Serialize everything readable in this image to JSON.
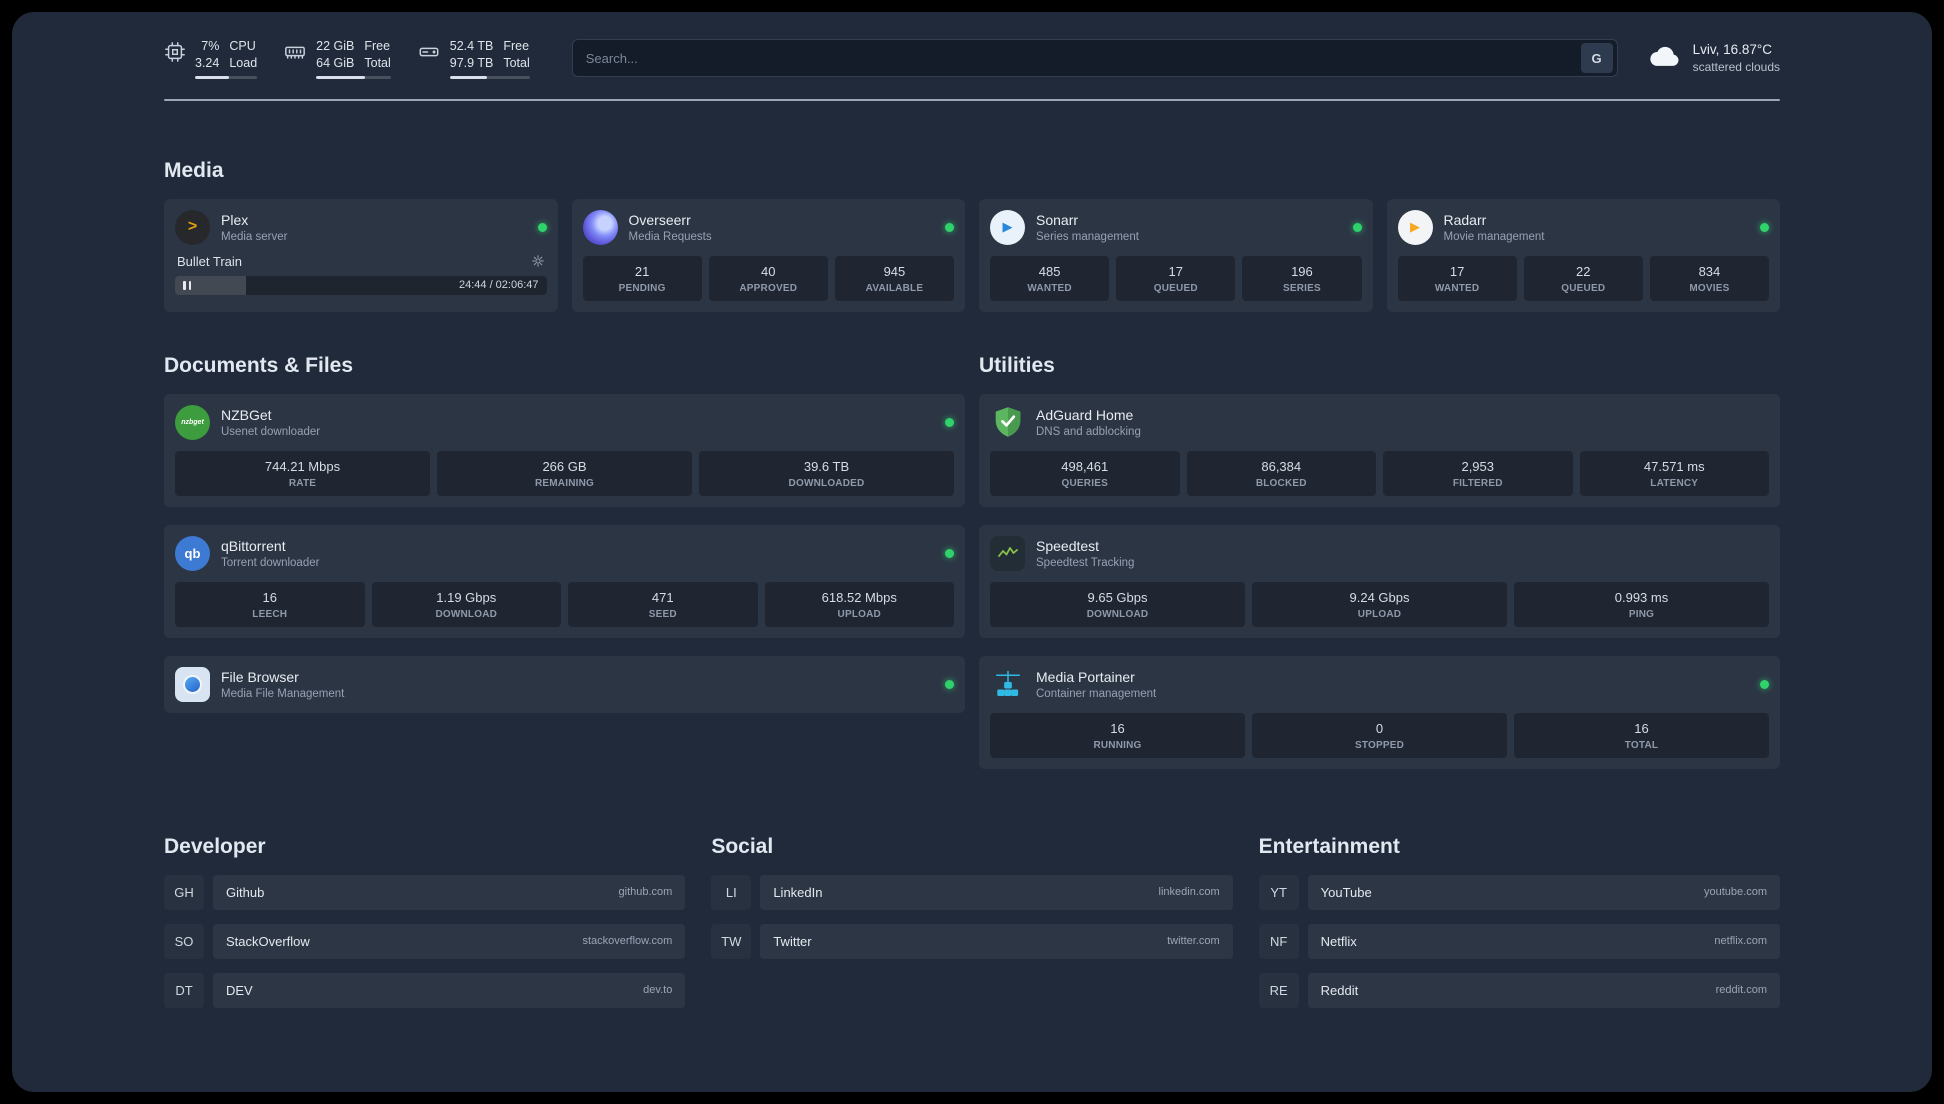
{
  "topbar": {
    "cpu": {
      "value1": "7%",
      "value2": "3.24",
      "label1": "CPU",
      "label2": "Load",
      "bar_percent": 55
    },
    "memory": {
      "value1": "22 GiB",
      "value2": "64 GiB",
      "label1": "Free",
      "label2": "Total",
      "bar_percent": 66
    },
    "disk": {
      "value1": "52.4 TB",
      "value2": "97.9 TB",
      "label1": "Free",
      "label2": "Total",
      "bar_percent": 47
    },
    "search": {
      "placeholder": "Search...",
      "provider_button": "G"
    },
    "weather": {
      "location": "Lviv, 16.87°C",
      "condition": "scattered clouds"
    }
  },
  "sections": {
    "media": {
      "title": "Media",
      "plex": {
        "name": "Plex",
        "desc": "Media server",
        "status": "online",
        "player": {
          "title": "Bullet Train",
          "time": "24:44 / 02:06:47",
          "progress_percent": 19
        }
      },
      "overseerr": {
        "name": "Overseerr",
        "desc": "Media Requests",
        "status": "online",
        "stats": [
          {
            "value": "21",
            "label": "PENDING"
          },
          {
            "value": "40",
            "label": "APPROVED"
          },
          {
            "value": "945",
            "label": "AVAILABLE"
          }
        ]
      },
      "sonarr": {
        "name": "Sonarr",
        "desc": "Series management",
        "status": "online",
        "stats": [
          {
            "value": "485",
            "label": "WANTED"
          },
          {
            "value": "17",
            "label": "QUEUED"
          },
          {
            "value": "196",
            "label": "SERIES"
          }
        ]
      },
      "radarr": {
        "name": "Radarr",
        "desc": "Movie management",
        "status": "online",
        "stats": [
          {
            "value": "17",
            "label": "WANTED"
          },
          {
            "value": "22",
            "label": "QUEUED"
          },
          {
            "value": "834",
            "label": "MOVIES"
          }
        ]
      }
    },
    "documents": {
      "title": "Documents & Files",
      "nzbget": {
        "name": "NZBGet",
        "desc": "Usenet downloader",
        "status": "online",
        "icon_label": "nzbget",
        "stats": [
          {
            "value": "744.21 Mbps",
            "label": "RATE"
          },
          {
            "value": "266 GB",
            "label": "REMAINING"
          },
          {
            "value": "39.6 TB",
            "label": "DOWNLOADED"
          }
        ]
      },
      "qbittorrent": {
        "name": "qBittorrent",
        "desc": "Torrent downloader",
        "status": "online",
        "icon_label": "qb",
        "stats": [
          {
            "value": "16",
            "label": "LEECH"
          },
          {
            "value": "1.19 Gbps",
            "label": "DOWNLOAD"
          },
          {
            "value": "471",
            "label": "SEED"
          },
          {
            "value": "618.52 Mbps",
            "label": "UPLOAD"
          }
        ]
      },
      "filebrowser": {
        "name": "File Browser",
        "desc": "Media File Management",
        "status": "online"
      }
    },
    "utilities": {
      "title": "Utilities",
      "adguard": {
        "name": "AdGuard Home",
        "desc": "DNS and adblocking",
        "stats": [
          {
            "value": "498,461",
            "label": "QUERIES"
          },
          {
            "value": "86,384",
            "label": "BLOCKED"
          },
          {
            "value": "2,953",
            "label": "FILTERED"
          },
          {
            "value": "47.571 ms",
            "label": "LATENCY"
          }
        ]
      },
      "speedtest": {
        "name": "Speedtest",
        "desc": "Speedtest Tracking",
        "stats": [
          {
            "value": "9.65 Gbps",
            "label": "DOWNLOAD"
          },
          {
            "value": "9.24 Gbps",
            "label": "UPLOAD"
          },
          {
            "value": "0.993 ms",
            "label": "PING"
          }
        ]
      },
      "portainer": {
        "name": "Media Portainer",
        "desc": "Container management",
        "status": "online",
        "stats": [
          {
            "value": "16",
            "label": "RUNNING"
          },
          {
            "value": "0",
            "label": "STOPPED"
          },
          {
            "value": "16",
            "label": "TOTAL"
          }
        ]
      }
    },
    "developer": {
      "title": "Developer",
      "links": [
        {
          "abbr": "GH",
          "name": "Github",
          "domain": "github.com"
        },
        {
          "abbr": "SO",
          "name": "StackOverflow",
          "domain": "stackoverflow.com"
        },
        {
          "abbr": "DT",
          "name": "DEV",
          "domain": "dev.to"
        }
      ]
    },
    "social": {
      "title": "Social",
      "links": [
        {
          "abbr": "LI",
          "name": "LinkedIn",
          "domain": "linkedin.com"
        },
        {
          "abbr": "TW",
          "name": "Twitter",
          "domain": "twitter.com"
        }
      ]
    },
    "entertainment": {
      "title": "Entertainment",
      "links": [
        {
          "abbr": "YT",
          "name": "YouTube",
          "domain": "youtube.com"
        },
        {
          "abbr": "NF",
          "name": "Netflix",
          "domain": "netflix.com"
        },
        {
          "abbr": "RE",
          "name": "Reddit",
          "domain": "reddit.com"
        }
      ]
    }
  },
  "colors": {
    "status_online": "#2fd26b",
    "plex_accent": "#e5a00d",
    "background": "#202a3a"
  }
}
